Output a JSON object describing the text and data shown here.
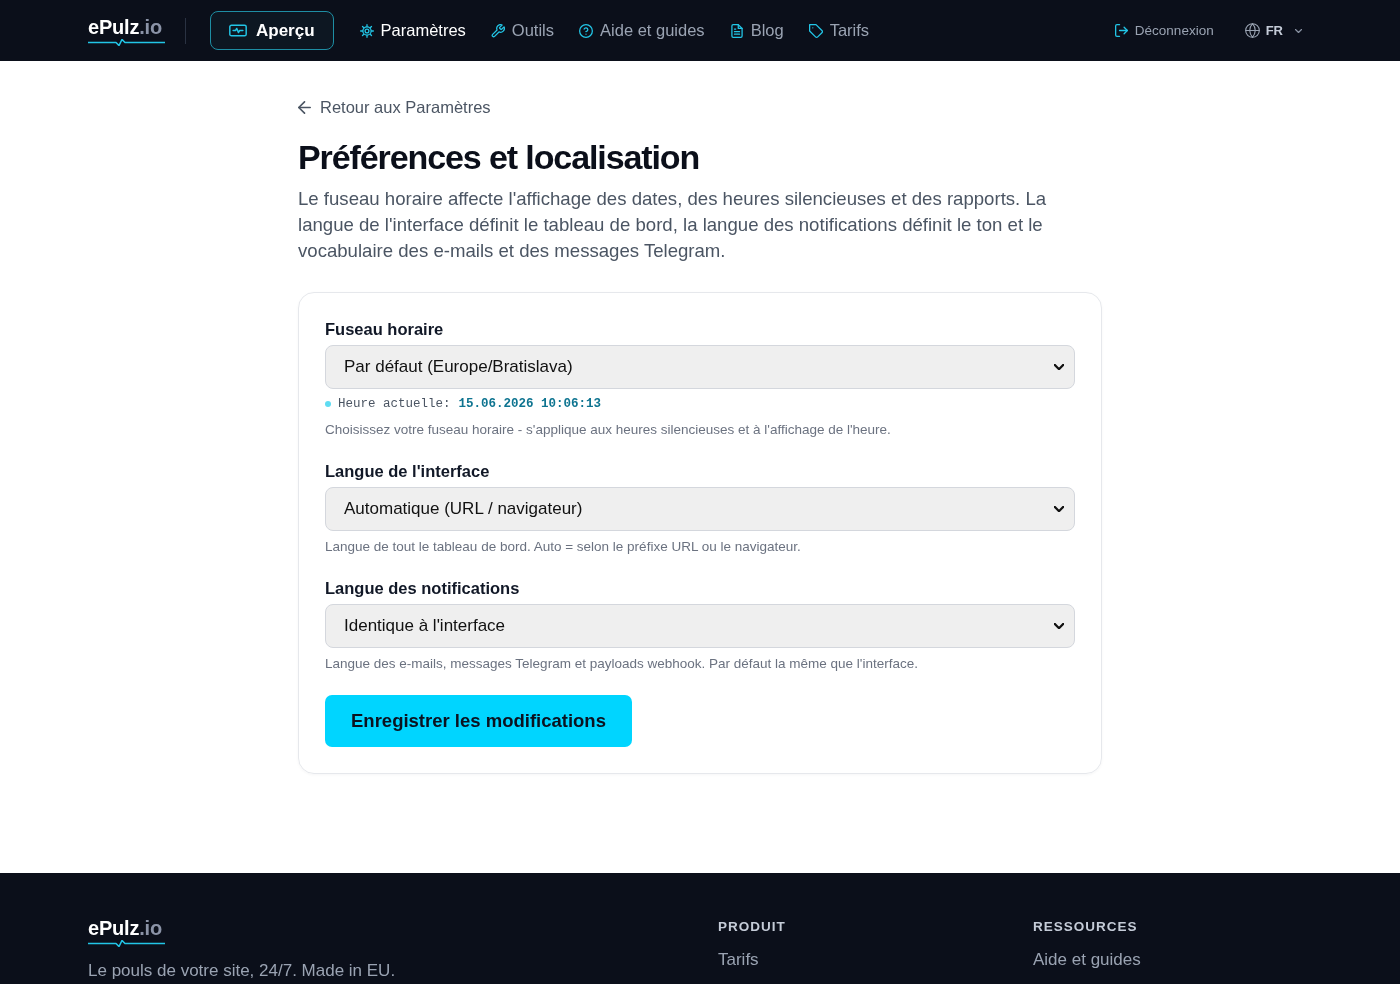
{
  "header": {
    "logo": {
      "name": "ePulz",
      "suffix": ".io"
    },
    "overview_button": {
      "label": "Aperçu"
    },
    "nav": [
      {
        "label": "Paramètres",
        "selected": true
      },
      {
        "label": "Outils",
        "selected": false
      },
      {
        "label": "Aide et guides",
        "selected": false
      },
      {
        "label": "Blog",
        "selected": false
      },
      {
        "label": "Tarifs",
        "selected": false
      }
    ],
    "logout": {
      "label": "Déconnexion"
    },
    "language": {
      "label": "FR"
    }
  },
  "page": {
    "back_link": "Retour aux Paramètres",
    "title": "Préférences et localisation",
    "description": "Le fuseau horaire affecte l'affichage des dates, des heures silencieuses et des rapports. La langue de l'interface définit le tableau de bord, la langue des notifications définit le ton et le vocabulaire des e-mails et des messages Telegram."
  },
  "form": {
    "fields": [
      {
        "label": "Fuseau horaire",
        "value": "Par défaut (Europe/Bratislava)",
        "clock": {
          "label": "Heure actuelle:",
          "value": "15.06.2026 10:06:13"
        },
        "help": "Choisissez votre fuseau horaire - s'applique aux heures silencieuses et à l'affichage de l'heure."
      },
      {
        "label": "Langue de l'interface",
        "value": "Automatique (URL / navigateur)",
        "help": "Langue de tout le tableau de bord. Auto = selon le préfixe URL ou le navigateur."
      },
      {
        "label": "Langue des notifications",
        "value": "Identique à l'interface",
        "help": "Langue des e-mails, messages Telegram et payloads webhook. Par défaut la même que l'interface."
      }
    ],
    "submit": "Enregistrer les modifications"
  },
  "footer": {
    "logo": {
      "name": "ePulz",
      "suffix": ".io"
    },
    "tagline": "Le pouls de votre site, 24/7. Made in EU.",
    "columns": [
      {
        "heading": "PRODUIT",
        "links": [
          "Tarifs"
        ]
      },
      {
        "heading": "RESSOURCES",
        "links": [
          "Aide et guides"
        ]
      }
    ]
  }
}
